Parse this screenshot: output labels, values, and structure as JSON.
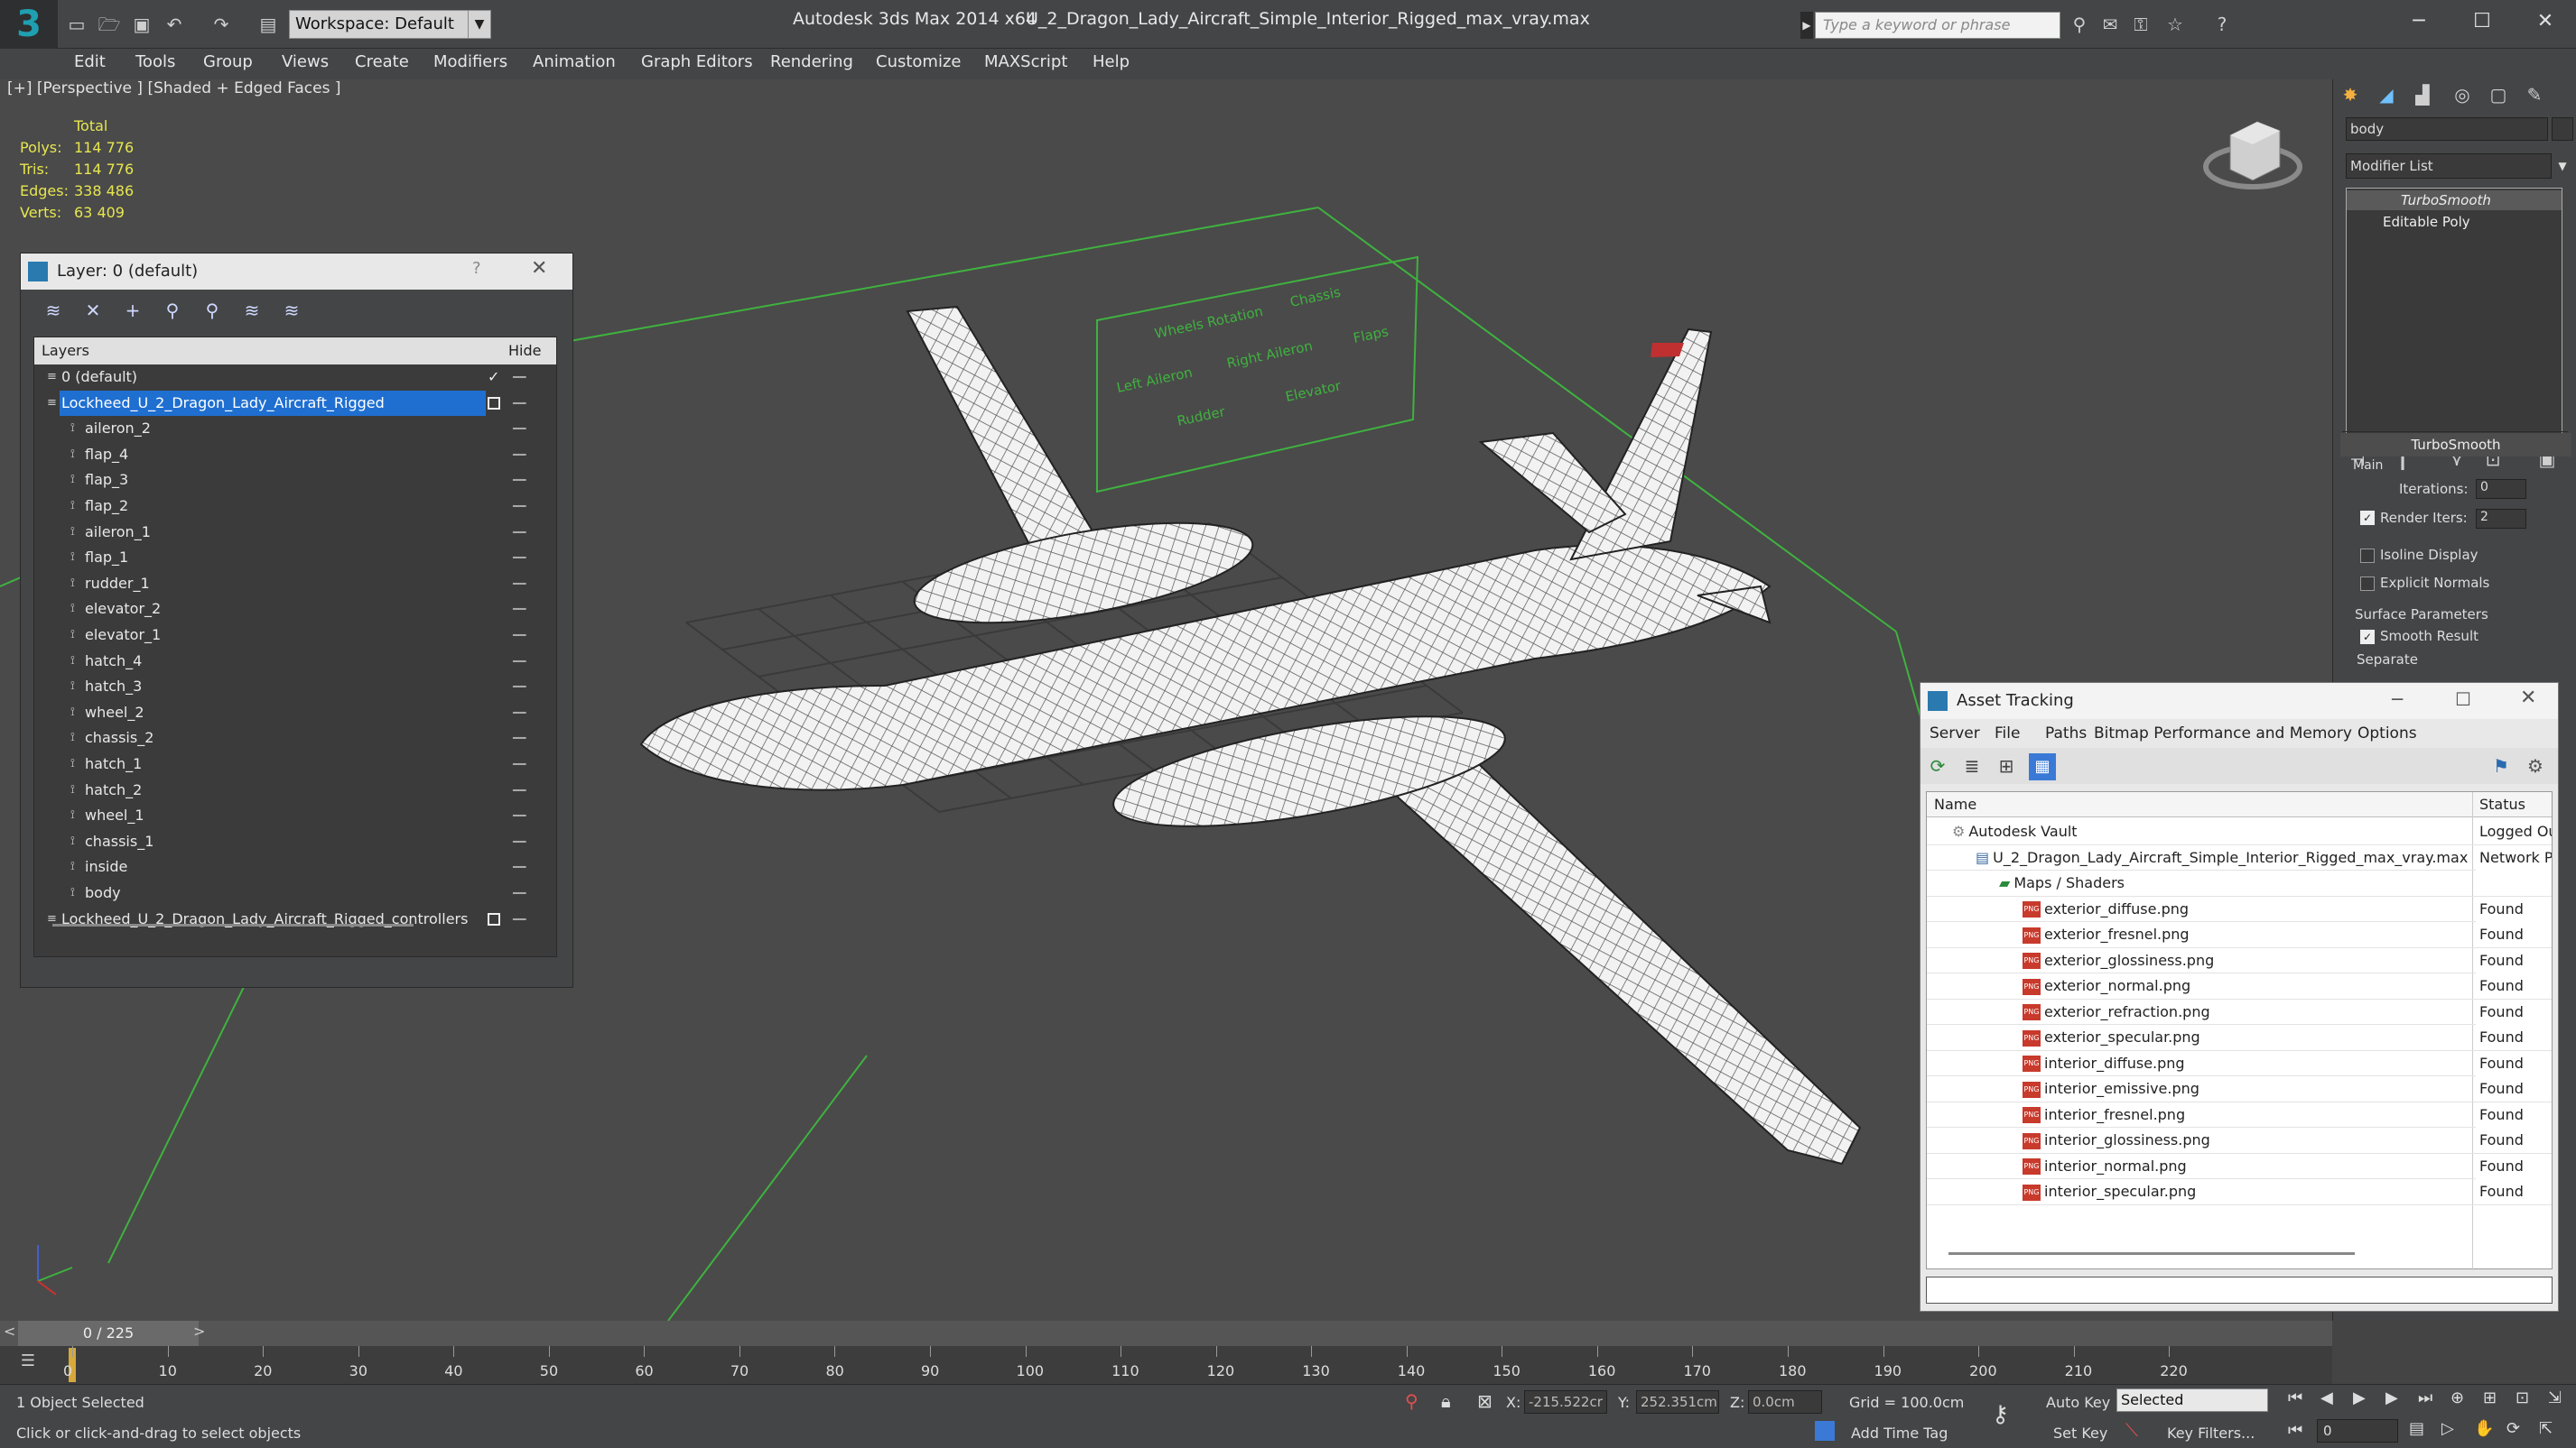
{
  "titlebar": {
    "workspace_label": "Workspace: Default",
    "app_title": "Autodesk 3ds Max  2014 x64",
    "file_title": "U_2_Dragon_Lady_Aircraft_Simple_Interior_Rigged_max_vray.max",
    "search_placeholder": "Type a keyword or phrase"
  },
  "menu": [
    "Edit",
    "Tools",
    "Group",
    "Views",
    "Create",
    "Modifiers",
    "Animation",
    "Graph Editors",
    "Rendering",
    "Customize",
    "MAXScript",
    "Help"
  ],
  "viewport": {
    "label": "[+] [Perspective ] [Shaded + Edged Faces ]",
    "stats": {
      "total_label": "Total",
      "polys_label": "Polys:",
      "polys": "114 776",
      "tris_label": "Tris:",
      "tris": "114 776",
      "edges_label": "Edges:",
      "edges": "338 486",
      "verts_label": "Verts:",
      "verts": "63 409"
    },
    "rig_labels": [
      "Wheels Rotation",
      "Chassis",
      "Right Aileron",
      "Flaps",
      "Left Aileron",
      "Rudder",
      "Elevator"
    ]
  },
  "layer_panel": {
    "title": "Layer: 0 (default)",
    "help": "?",
    "col_layers": "Layers",
    "col_hide": "Hide",
    "rows": [
      {
        "name": "0 (default)",
        "level": 0
      },
      {
        "name": "Lockheed_U_2_Dragon_Lady_Aircraft_Rigged",
        "level": 0
      },
      {
        "name": "aileron_2",
        "level": 1
      },
      {
        "name": "flap_4",
        "level": 1
      },
      {
        "name": "flap_3",
        "level": 1
      },
      {
        "name": "flap_2",
        "level": 1
      },
      {
        "name": "aileron_1",
        "level": 1
      },
      {
        "name": "flap_1",
        "level": 1
      },
      {
        "name": "rudder_1",
        "level": 1
      },
      {
        "name": "elevator_2",
        "level": 1
      },
      {
        "name": "elevator_1",
        "level": 1
      },
      {
        "name": "hatch_4",
        "level": 1
      },
      {
        "name": "hatch_3",
        "level": 1
      },
      {
        "name": "wheel_2",
        "level": 1
      },
      {
        "name": "chassis_2",
        "level": 1
      },
      {
        "name": "hatch_1",
        "level": 1
      },
      {
        "name": "hatch_2",
        "level": 1
      },
      {
        "name": "wheel_1",
        "level": 1
      },
      {
        "name": "chassis_1",
        "level": 1
      },
      {
        "name": "inside",
        "level": 1
      },
      {
        "name": "body",
        "level": 1
      },
      {
        "name": "Lockheed_U_2_Dragon_Lady_Aircraft_Rigged_controllers",
        "level": 0
      }
    ]
  },
  "command_panel": {
    "object_name": "body",
    "modifier_list": "Modifier List",
    "stack": [
      "TurboSmooth",
      "Editable Poly"
    ],
    "rollout_title": "TurboSmooth",
    "main_label": "Main",
    "iterations_label": "Iterations:",
    "iterations": "0",
    "render_iters_label": "Render Iters:",
    "render_iters": "2",
    "isoline_label": "Isoline Display",
    "explicit_label": "Explicit Normals",
    "surface_label": "Surface Parameters",
    "smooth_label": "Smooth Result",
    "separate_label": "Separate"
  },
  "asset_tracking": {
    "title": "Asset Tracking",
    "menu": [
      "Server",
      "File",
      "Paths",
      "Bitmap Performance and Memory",
      "Options"
    ],
    "col_name": "Name",
    "col_status": "Status",
    "rows": [
      {
        "name": "Autodesk Vault",
        "status": "Logged Ou",
        "level": 0,
        "icon": "vault-icon"
      },
      {
        "name": "U_2_Dragon_Lady_Aircraft_Simple_Interior_Rigged_max_vray.max",
        "status": "Network P",
        "level": 1,
        "icon": "max-file-icon"
      },
      {
        "name": "Maps / Shaders",
        "status": "",
        "level": 2,
        "icon": "maps-icon"
      },
      {
        "name": "exterior_diffuse.png",
        "status": "Found",
        "level": 3,
        "icon": "png-icon"
      },
      {
        "name": "exterior_fresnel.png",
        "status": "Found",
        "level": 3,
        "icon": "png-icon"
      },
      {
        "name": "exterior_glossiness.png",
        "status": "Found",
        "level": 3,
        "icon": "png-icon"
      },
      {
        "name": "exterior_normal.png",
        "status": "Found",
        "level": 3,
        "icon": "png-icon"
      },
      {
        "name": "exterior_refraction.png",
        "status": "Found",
        "level": 3,
        "icon": "png-icon"
      },
      {
        "name": "exterior_specular.png",
        "status": "Found",
        "level": 3,
        "icon": "png-icon"
      },
      {
        "name": "interior_diffuse.png",
        "status": "Found",
        "level": 3,
        "icon": "png-icon"
      },
      {
        "name": "interior_emissive.png",
        "status": "Found",
        "level": 3,
        "icon": "png-icon"
      },
      {
        "name": "interior_fresnel.png",
        "status": "Found",
        "level": 3,
        "icon": "png-icon"
      },
      {
        "name": "interior_glossiness.png",
        "status": "Found",
        "level": 3,
        "icon": "png-icon"
      },
      {
        "name": "interior_normal.png",
        "status": "Found",
        "level": 3,
        "icon": "png-icon"
      },
      {
        "name": "interior_specular.png",
        "status": "Found",
        "level": 3,
        "icon": "png-icon"
      }
    ]
  },
  "timeline": {
    "frame_display": "0 / 225",
    "ticks": [
      "0",
      "10",
      "20",
      "30",
      "40",
      "50",
      "60",
      "70",
      "80",
      "90",
      "100",
      "110",
      "120",
      "130",
      "140",
      "150",
      "160",
      "170",
      "180",
      "190",
      "200",
      "210",
      "220"
    ]
  },
  "status": {
    "selection": "1 Object Selected",
    "prompt": "Click or click-and-drag to select objects",
    "x_label": "X:",
    "x": "-215.522cr",
    "y_label": "Y:",
    "y": "252.351cm",
    "z_label": "Z:",
    "z": "0.0cm",
    "grid": "Grid = 100.0cm",
    "auto_key": "Auto Key",
    "selected": "Selected",
    "set_key": "Set Key",
    "key_filters": "Key Filters...",
    "frame": "0",
    "add_time_tag": "Add Time Tag"
  },
  "colors": {
    "selection_blue": "#1f6fd1",
    "stats_yellow": "#e6e650",
    "grid_green": "#3fb23f",
    "app_teal": "#1f9fb0"
  }
}
